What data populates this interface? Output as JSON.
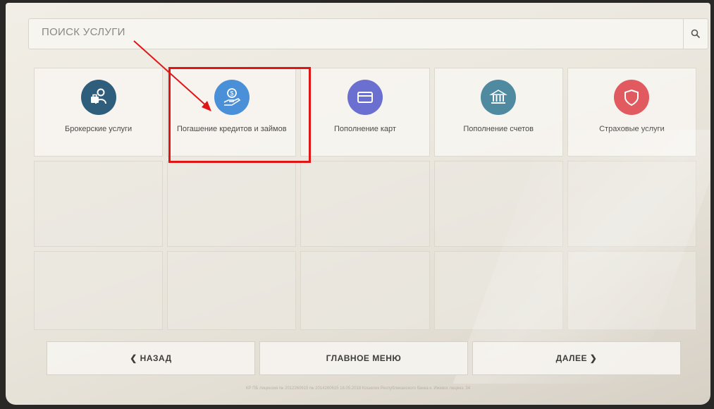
{
  "search": {
    "placeholder": "ПОИСК УСЛУГИ"
  },
  "tiles": [
    {
      "label": "Брокерские услуги",
      "icon": "briefcase-person-icon",
      "color": "#2f5d7c"
    },
    {
      "label": "Погашение кредитов и займов",
      "icon": "coin-hand-icon",
      "color": "#4a90d9"
    },
    {
      "label": "Пополнение карт",
      "icon": "card-icon",
      "color": "#6a6fd0"
    },
    {
      "label": "Пополнение счетов",
      "icon": "bank-icon",
      "color": "#4f8aa0"
    },
    {
      "label": "Страховые услуги",
      "icon": "shield-icon",
      "color": "#e05a60"
    }
  ],
  "nav": {
    "back": "❮ НАЗАД",
    "main_menu": "ГЛАВНОЕ МЕНЮ",
    "next": "ДАЛЕЕ ❯"
  },
  "footer_text": "КР ПБ лицензия № 2012260615 № 2014260615 16.05.2018 Кошелек Республиканского банка к. Ижевск лиценз. 34"
}
